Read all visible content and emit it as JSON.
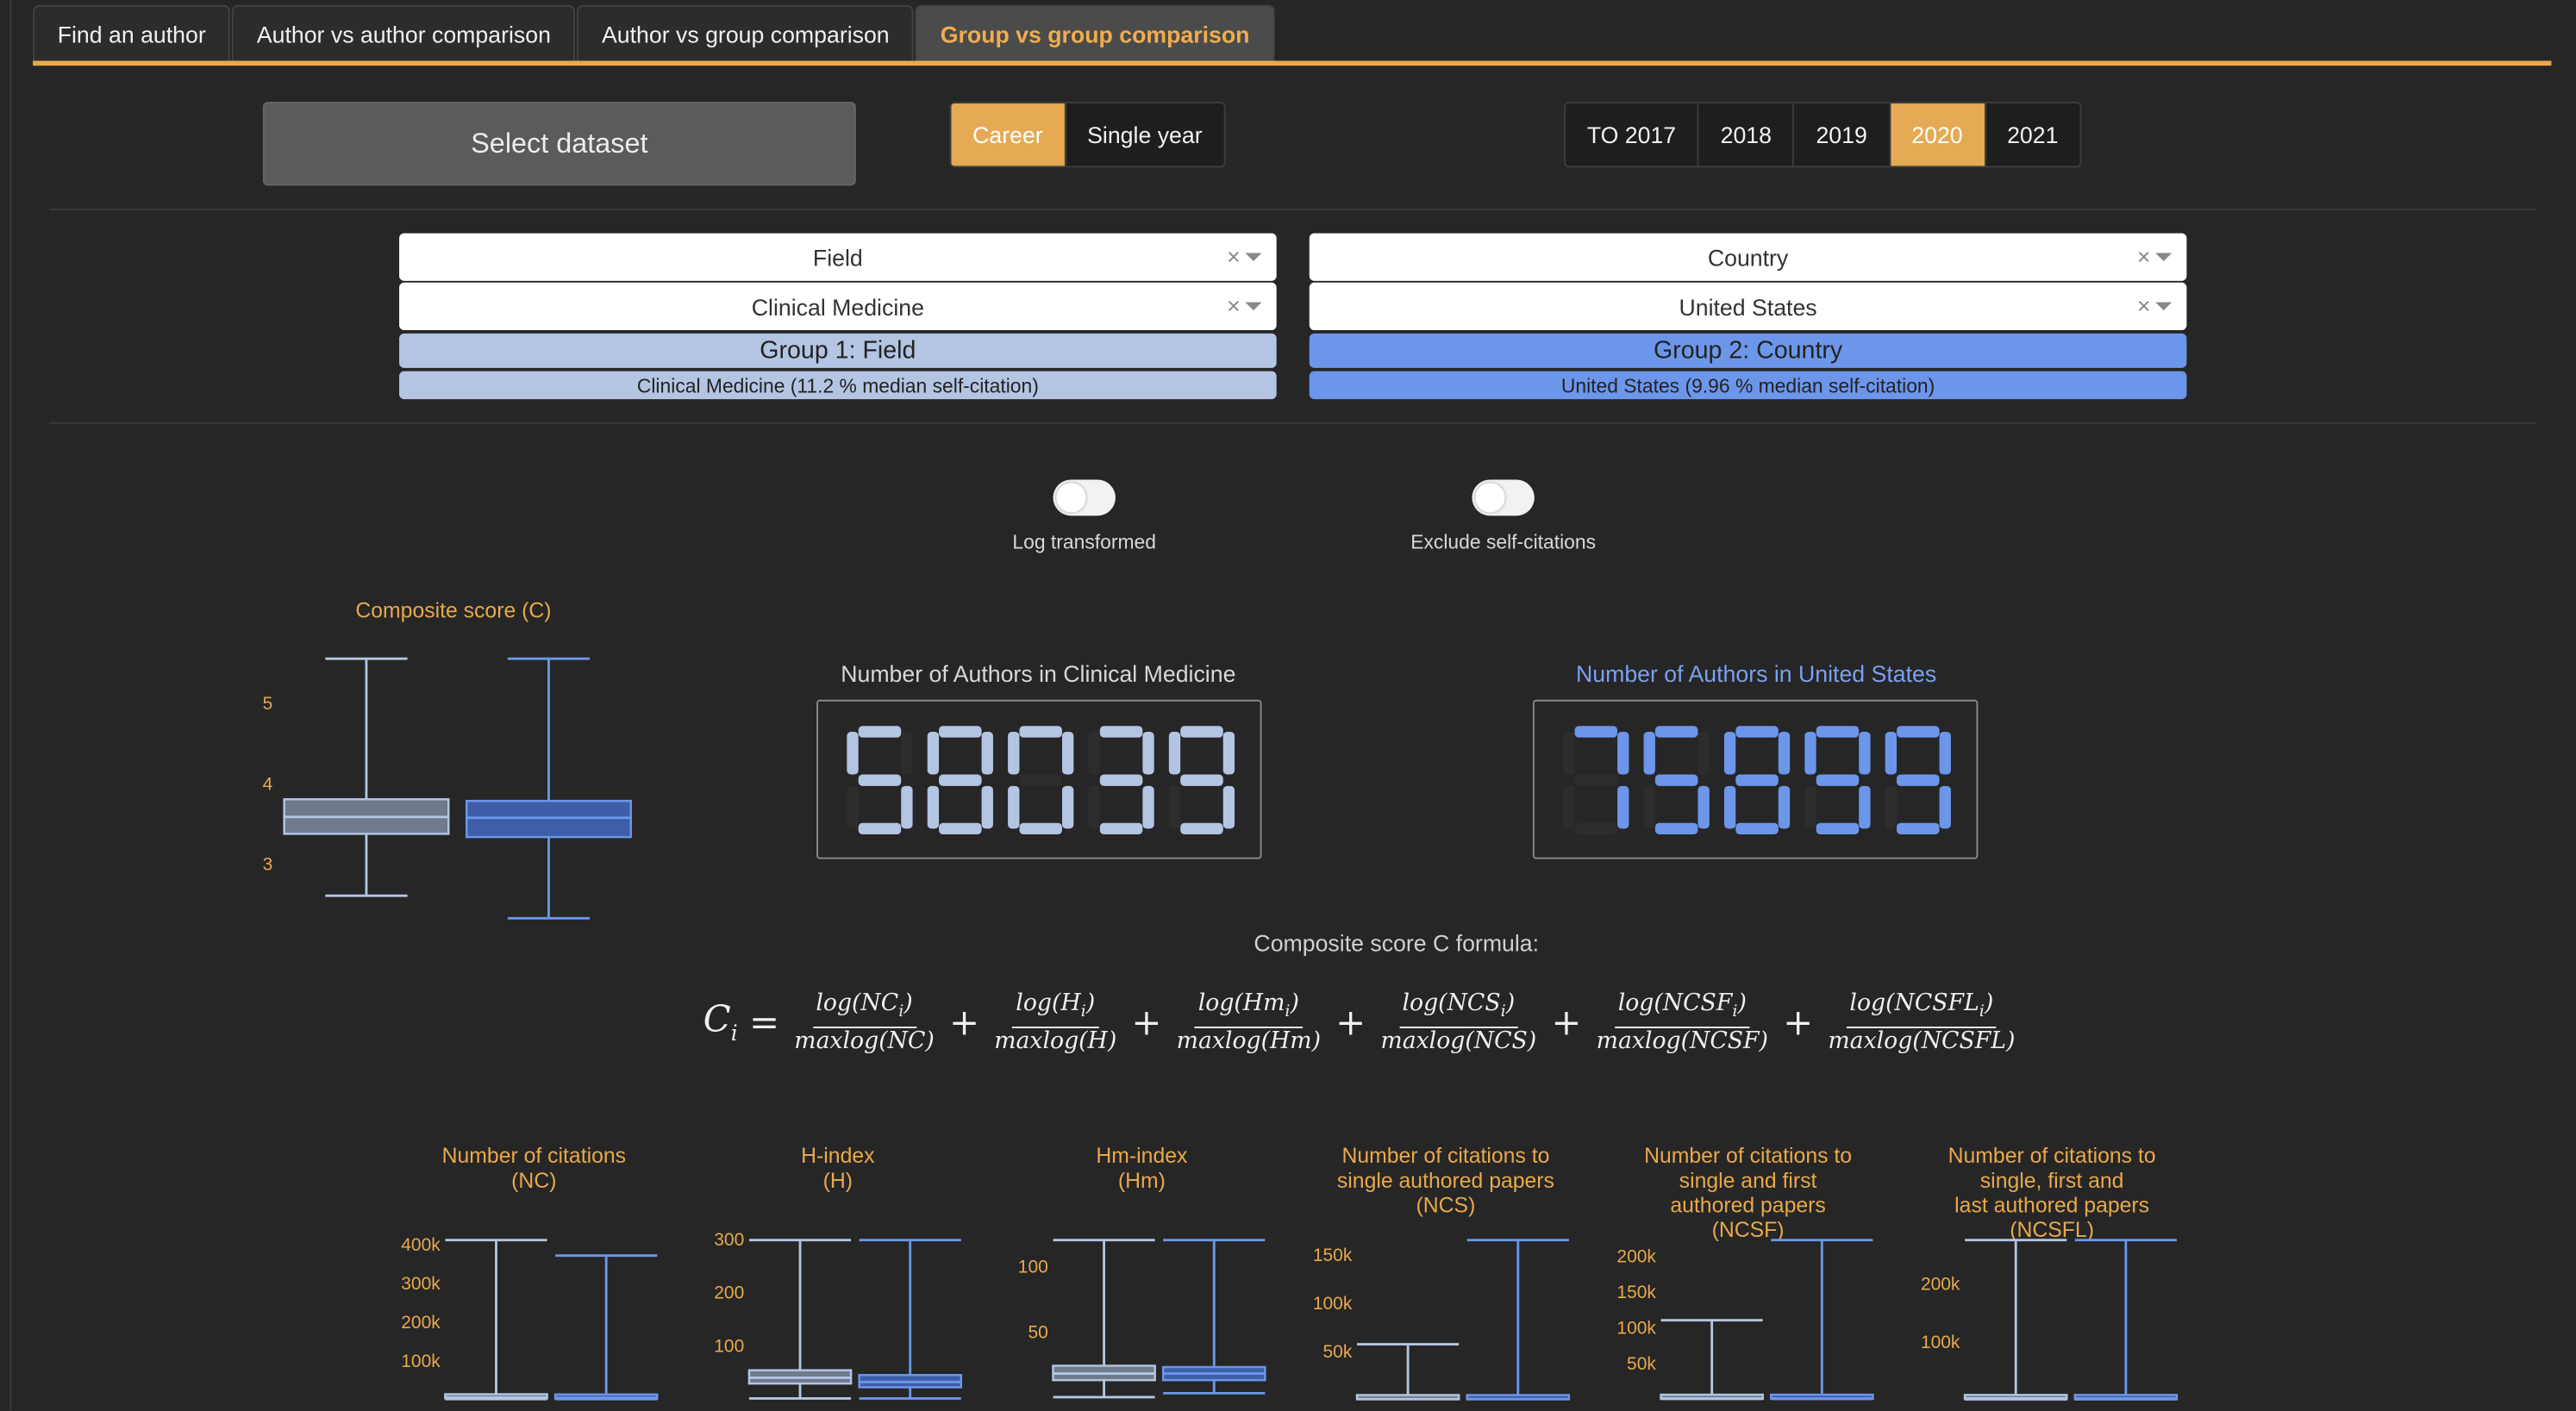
{
  "tabs": [
    {
      "label": "Find an author",
      "active": false
    },
    {
      "label": "Author vs author comparison",
      "active": false
    },
    {
      "label": "Author vs group comparison",
      "active": false
    },
    {
      "label": "Group vs group comparison",
      "active": true
    }
  ],
  "dataset_button": "Select dataset",
  "mode_buttons": [
    {
      "label": "Career",
      "selected": true
    },
    {
      "label": "Single year",
      "selected": false
    }
  ],
  "year_buttons": [
    {
      "label": "TO 2017",
      "selected": false
    },
    {
      "label": "2018",
      "selected": false
    },
    {
      "label": "2019",
      "selected": false
    },
    {
      "label": "2020",
      "selected": true
    },
    {
      "label": "2021",
      "selected": false
    }
  ],
  "group1": {
    "type_value": "Field",
    "selection_value": "Clinical Medicine",
    "label": "Group 1: Field",
    "summary": "Clinical Medicine (11.2 % median self-citation)",
    "color": "#b3c5e3"
  },
  "group2": {
    "type_value": "Country",
    "selection_value": "United States",
    "label": "Group 2: Country",
    "summary": "United States (9.96 % median self-citation)",
    "color": "#6c96ea"
  },
  "toggles": [
    {
      "label": "Log transformed",
      "on": false
    },
    {
      "label": "Exclude self-citations",
      "on": false
    }
  ],
  "counters": {
    "group1": {
      "title": "Number of Authors in Clinical Medicine",
      "value": "58039"
    },
    "group2": {
      "title": "Number of Authors in United States",
      "value": "75899"
    }
  },
  "formula": {
    "caption": "Composite score C formula:",
    "lhs": "C",
    "lhs_sub": "i",
    "terms": [
      {
        "num": "log(NC",
        "num_sub": "i",
        "den": "maxlog(NC)"
      },
      {
        "num": "log(H",
        "num_sub": "i",
        "den": "maxlog(H)"
      },
      {
        "num": "log(Hm",
        "num_sub": "i",
        "den": "maxlog(Hm)"
      },
      {
        "num": "log(NCS",
        "num_sub": "i",
        "den": "maxlog(NCS)"
      },
      {
        "num": "log(NCSF",
        "num_sub": "i",
        "den": "maxlog(NCSF)"
      },
      {
        "num": "log(NCSFL",
        "num_sub": "i",
        "den": "maxlog(NCSFL)"
      }
    ]
  },
  "chart_data": [
    {
      "type": "box",
      "title": "Composite score (C)",
      "yticks": [
        3,
        4,
        5
      ],
      "ylim": [
        2.3,
        5.55
      ],
      "series": [
        {
          "min": 2.6,
          "q1": 3.37,
          "median": 3.58,
          "q3": 3.8,
          "max": 5.55
        },
        {
          "min": 2.32,
          "q1": 3.33,
          "median": 3.57,
          "q3": 3.78,
          "max": 5.55
        }
      ]
    },
    {
      "type": "box",
      "title": "Number of citations\n(NC)",
      "yticks": [
        "100k",
        "200k",
        "300k",
        "400k"
      ],
      "ytick_values": [
        100000,
        200000,
        300000,
        400000
      ],
      "ylim": [
        -5000,
        410000
      ],
      "series": [
        {
          "min": 0,
          "q1": 2000,
          "median": 4000,
          "q3": 9000,
          "max": 410000
        },
        {
          "min": 0,
          "q1": 1500,
          "median": 3500,
          "q3": 8000,
          "max": 370000
        }
      ]
    },
    {
      "type": "box",
      "title": "H-index\n(H)",
      "yticks": [
        "100",
        "200",
        "300"
      ],
      "ytick_values": [
        100,
        200,
        300
      ],
      "ylim": [
        -5,
        298
      ],
      "series": [
        {
          "min": 0,
          "q1": 28,
          "median": 39,
          "q3": 53,
          "max": 298
        },
        {
          "min": 0,
          "q1": 21,
          "median": 31,
          "q3": 44,
          "max": 298
        }
      ]
    },
    {
      "type": "box",
      "title": "Hm-index\n(Hm)",
      "yticks": [
        "50",
        "100"
      ],
      "ytick_values": [
        50,
        100
      ],
      "ylim": [
        -3,
        120
      ],
      "series": [
        {
          "min": 0,
          "q1": 13,
          "median": 18,
          "q3": 24,
          "max": 120
        },
        {
          "min": 3,
          "q1": 13,
          "median": 18,
          "q3": 23,
          "max": 120
        }
      ]
    },
    {
      "type": "box",
      "title": "Number of citations to\nsingle authored papers\n(NCS)",
      "yticks": [
        "50k",
        "100k",
        "150k"
      ],
      "ytick_values": [
        50000,
        100000,
        150000
      ],
      "ylim": [
        -2000,
        165000
      ],
      "series": [
        {
          "min": 0,
          "q1": 0,
          "median": 0,
          "q3": 500,
          "max": 57000
        },
        {
          "min": 0,
          "q1": 0,
          "median": 0,
          "q3": 500,
          "max": 165000
        }
      ]
    },
    {
      "type": "box",
      "title": "Number of citations to\nsingle and first\nauthored papers\n(NCSF)",
      "yticks": [
        "50k",
        "100k",
        "150k",
        "200k"
      ],
      "ytick_values": [
        50000,
        100000,
        150000,
        200000
      ],
      "ylim": [
        -3000,
        222000
      ],
      "series": [
        {
          "min": 0,
          "q1": 200,
          "median": 600,
          "q3": 1500,
          "max": 110000
        },
        {
          "min": 0,
          "q1": 200,
          "median": 600,
          "q3": 1500,
          "max": 222000
        }
      ]
    },
    {
      "type": "box",
      "title": "Number of citations to\nsingle, first and\nlast authored papers\n(NCSFL)",
      "yticks": [
        "100k",
        "200k"
      ],
      "ytick_values": [
        100000,
        200000
      ],
      "ylim": [
        -3000,
        275000
      ],
      "series": [
        {
          "min": 0,
          "q1": 500,
          "median": 1500,
          "q3": 3000,
          "max": 275000
        },
        {
          "min": 0,
          "q1": 500,
          "median": 1500,
          "q3": 3000,
          "max": 275000
        }
      ]
    }
  ]
}
